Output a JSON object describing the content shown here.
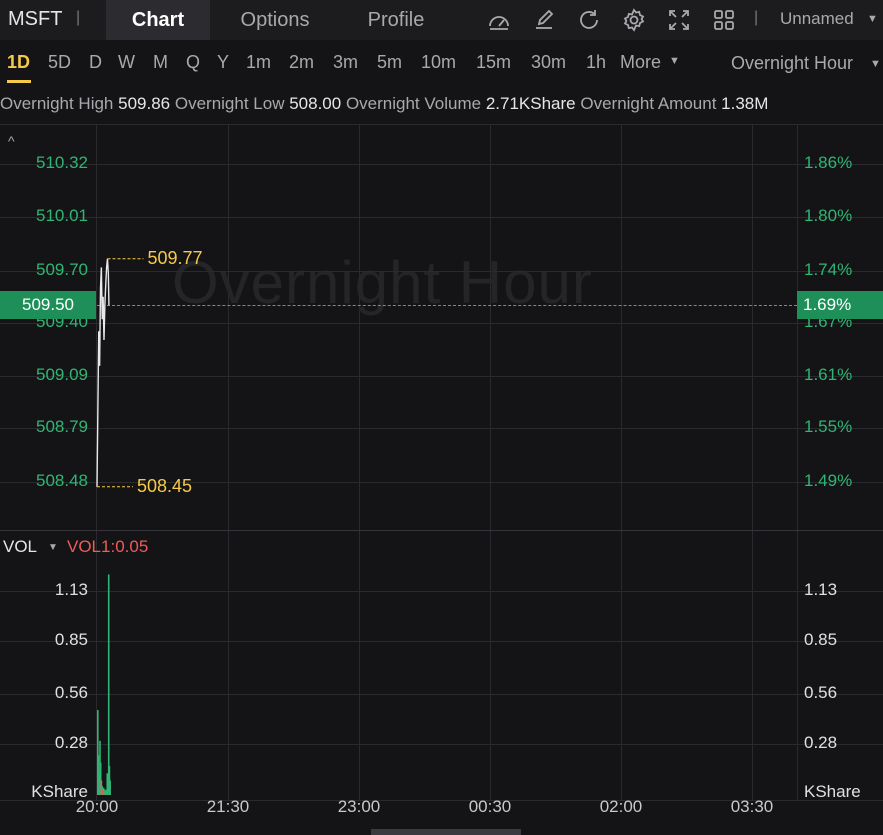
{
  "header": {
    "symbol": "MSFT",
    "separator": "|",
    "tabs": {
      "chart": "Chart",
      "options": "Options",
      "profile": "Profile"
    },
    "workspace": "Unnamed",
    "icons": [
      "speedometer-icon",
      "edit-icon",
      "refresh-icon",
      "gear-icon",
      "fullscreen-icon",
      "grid-layout-icon"
    ]
  },
  "periods": {
    "items": [
      "1D",
      "5D",
      "D",
      "W",
      "M",
      "Q",
      "Y",
      "1m",
      "2m",
      "3m",
      "5m",
      "10m",
      "15m",
      "30m",
      "1h",
      "More"
    ],
    "active": "1D",
    "session": "Overnight Hour"
  },
  "info": {
    "high_label": "Overnight High",
    "high_value": "509.86",
    "low_label": "Overnight Low",
    "low_value": "508.00",
    "volume_label": "Overnight Volume",
    "volume_value": "2.71KShare",
    "amount_label": "Overnight Amount",
    "amount_value": "1.38M"
  },
  "watermark": "Overnight Hour",
  "chart_data": [
    {
      "type": "line",
      "price_ticks": [
        "510.32",
        "510.01",
        "509.70",
        "509.40",
        "509.09",
        "508.79",
        "508.48"
      ],
      "percent_ticks": [
        "1.86%",
        "1.80%",
        "1.74%",
        "1.67%",
        "1.61%",
        "1.55%",
        "1.49%"
      ],
      "ylim": [
        508.2,
        510.55
      ],
      "current_price": "509.50",
      "current_percent": "1.69%",
      "high_label": "509.77",
      "low_label": "508.45",
      "x_ticks": [
        "20:00",
        "21:30",
        "23:00",
        "00:30",
        "02:00",
        "03:30"
      ],
      "x_minutes": [
        0,
        90,
        180,
        270,
        360,
        450
      ],
      "points": [
        {
          "t": 0.0,
          "v": 508.45
        },
        {
          "t": 0.6,
          "v": 508.9
        },
        {
          "t": 1.2,
          "v": 509.35
        },
        {
          "t": 1.8,
          "v": 509.15
        },
        {
          "t": 2.4,
          "v": 509.6
        },
        {
          "t": 3.0,
          "v": 509.72
        },
        {
          "t": 3.6,
          "v": 509.42
        },
        {
          "t": 4.2,
          "v": 509.55
        },
        {
          "t": 4.8,
          "v": 509.3
        },
        {
          "t": 5.4,
          "v": 509.5
        },
        {
          "t": 6.0,
          "v": 509.62
        },
        {
          "t": 6.6,
          "v": 509.72
        },
        {
          "t": 7.2,
          "v": 509.77
        },
        {
          "t": 7.8,
          "v": 509.68
        },
        {
          "t": 8.2,
          "v": 509.5
        }
      ]
    },
    {
      "type": "bar",
      "name": "VOL",
      "indicator": "VOL1:0.05",
      "ticks": [
        "1.13",
        "0.85",
        "0.56",
        "0.28"
      ],
      "unit": "KShare",
      "ylim": [
        0,
        1.3
      ],
      "bars": [
        {
          "t": 0.0,
          "v": 0.47,
          "dir": "up"
        },
        {
          "t": 0.5,
          "v": 0.22,
          "dir": "up"
        },
        {
          "t": 1.0,
          "v": 0.12,
          "dir": "up"
        },
        {
          "t": 1.5,
          "v": 0.3,
          "dir": "up"
        },
        {
          "t": 2.0,
          "v": 0.18,
          "dir": "up"
        },
        {
          "t": 2.5,
          "v": 0.08,
          "dir": "down"
        },
        {
          "t": 3.0,
          "v": 0.05,
          "dir": "up"
        },
        {
          "t": 3.5,
          "v": 0.03,
          "dir": "down"
        },
        {
          "t": 4.0,
          "v": 0.04,
          "dir": "up"
        },
        {
          "t": 4.5,
          "v": 0.02,
          "dir": "down"
        },
        {
          "t": 5.0,
          "v": 0.03,
          "dir": "up"
        },
        {
          "t": 5.5,
          "v": 0.02,
          "dir": "down"
        },
        {
          "t": 6.0,
          "v": 0.03,
          "dir": "up"
        },
        {
          "t": 6.5,
          "v": 0.12,
          "dir": "up"
        },
        {
          "t": 7.0,
          "v": 0.04,
          "dir": "down"
        },
        {
          "t": 7.5,
          "v": 1.22,
          "dir": "up"
        },
        {
          "t": 8.0,
          "v": 0.16,
          "dir": "up"
        },
        {
          "t": 8.5,
          "v": 0.08,
          "dir": "up"
        }
      ]
    }
  ],
  "colors": {
    "up": "#2fb574",
    "down": "#f05a5a",
    "accent": "#f7c948",
    "line": "#e8e8e8"
  }
}
